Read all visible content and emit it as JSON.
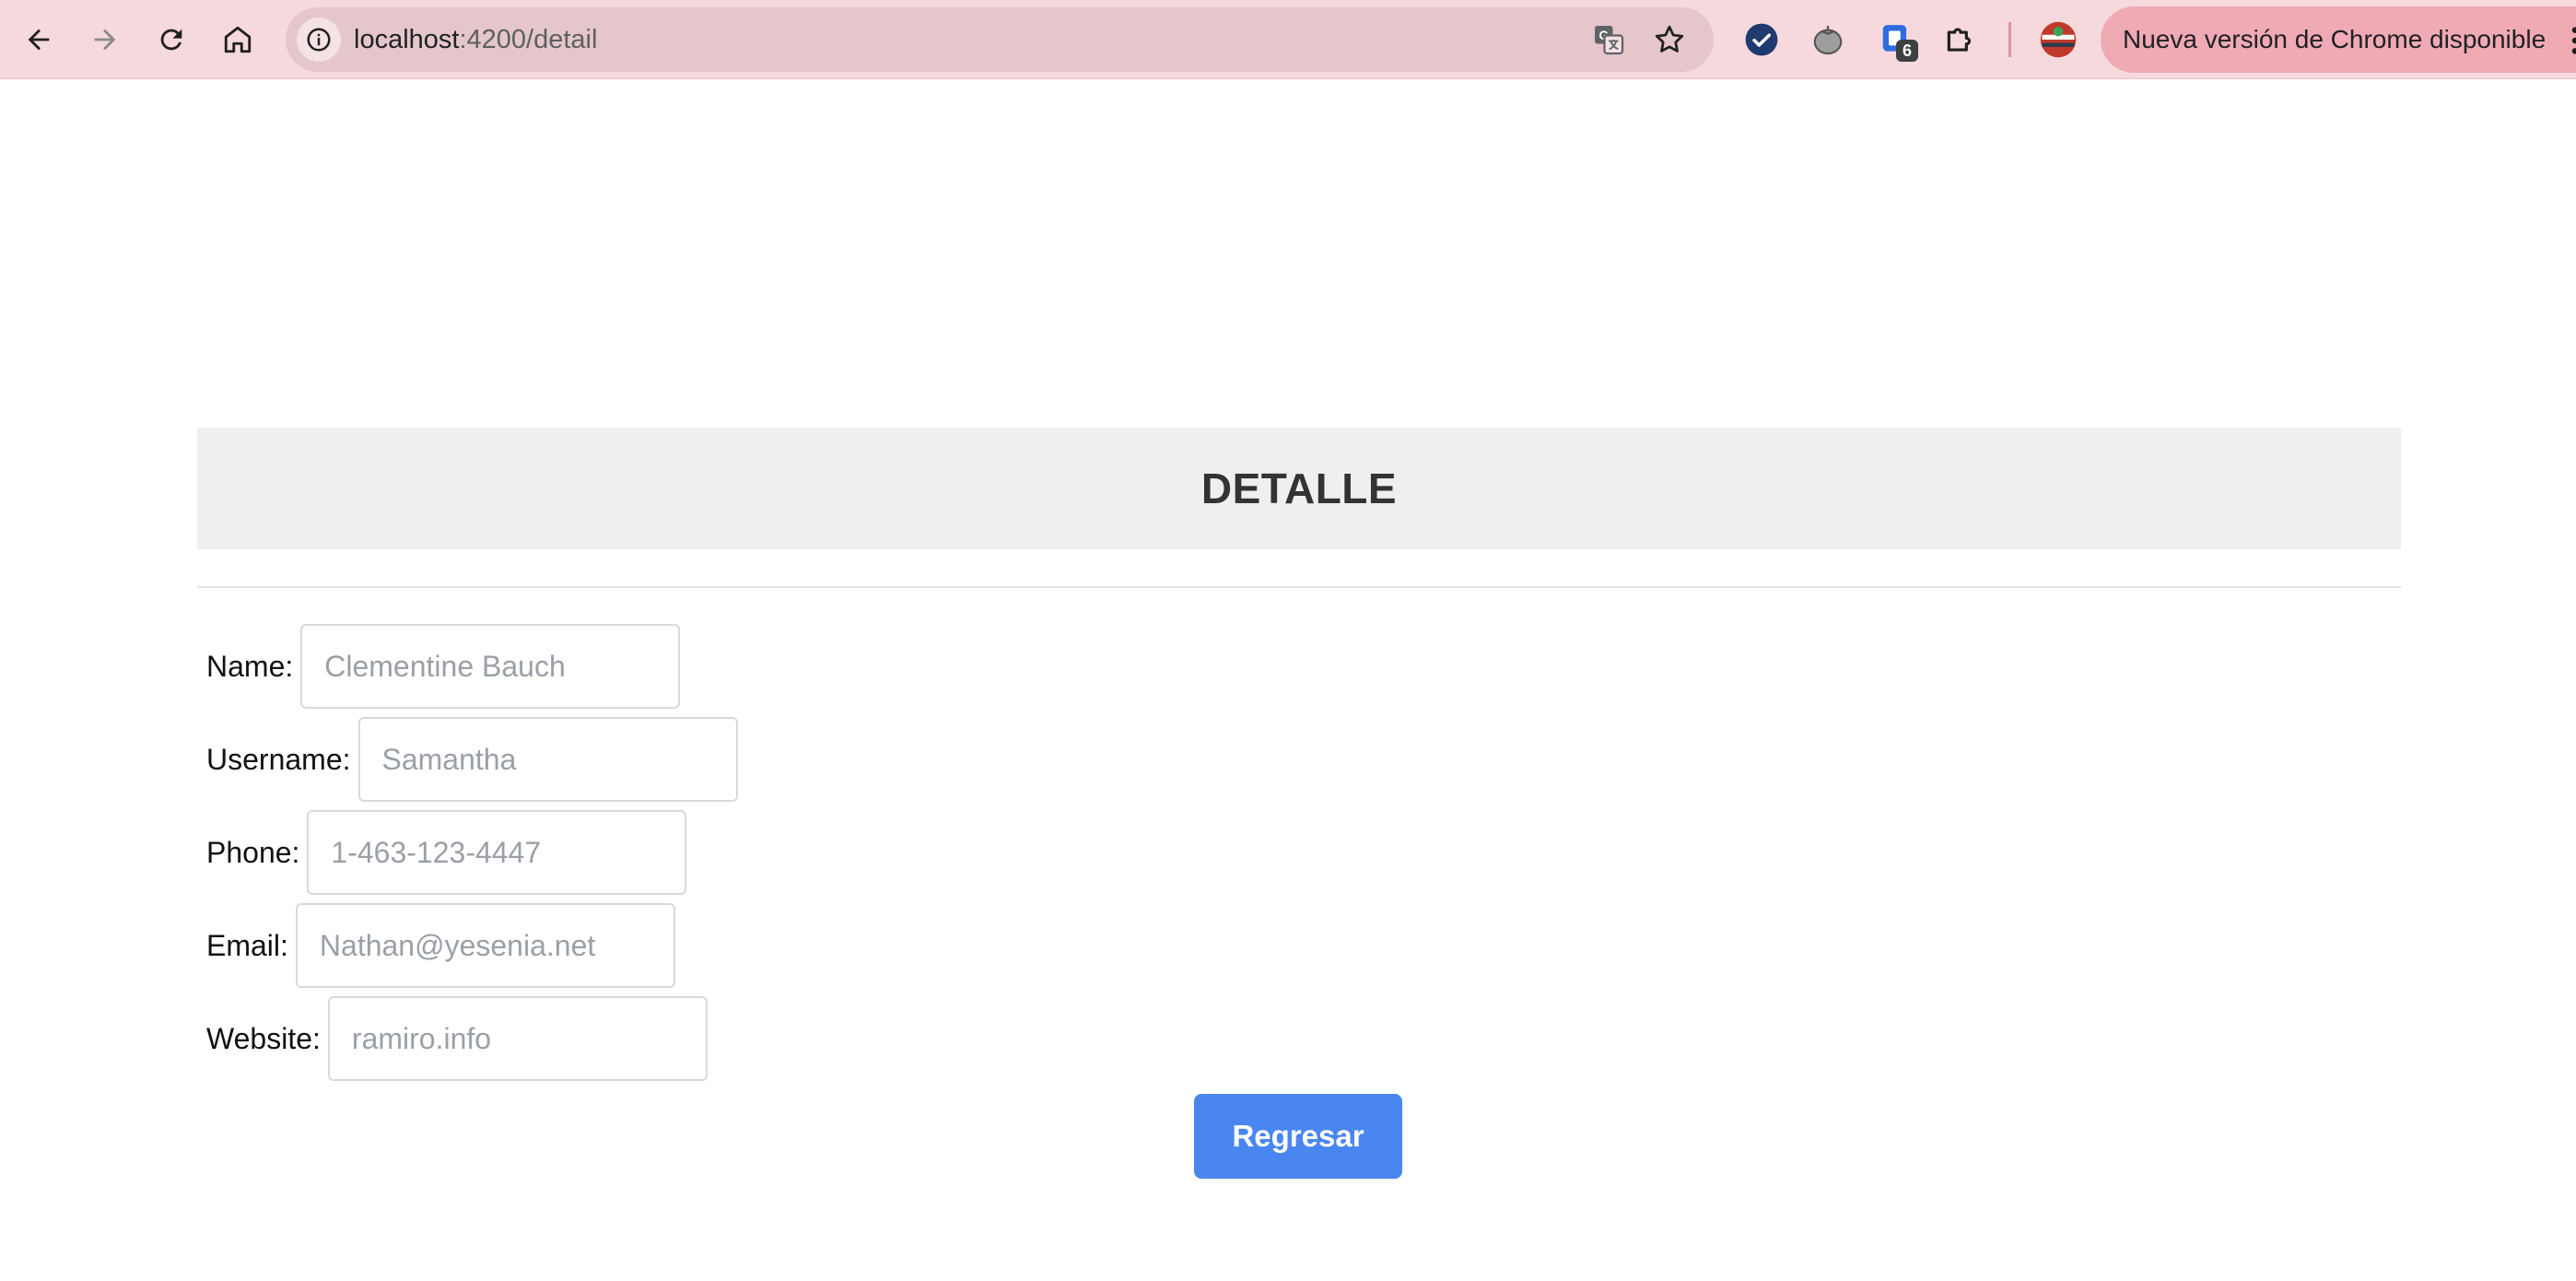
{
  "browser": {
    "url_host": "localhost",
    "url_path": ":4200/detail",
    "extension_badge": "6",
    "update_label": "Nueva versión de Chrome disponible",
    "icons": [
      "back-arrow-icon",
      "forward-arrow-icon",
      "reload-icon",
      "home-icon",
      "site-info-icon",
      "translate-icon",
      "bookmark-star-icon",
      "checkmark-extension-icon",
      "tomato-extension-icon",
      "badge-extension-icon",
      "puzzle-extensions-icon",
      "profile-avatar-icon",
      "more-vert-icon"
    ]
  },
  "page": {
    "title": "DETALLE",
    "fields": [
      {
        "label": "Name:",
        "placeholder": "Clementine Bauch"
      },
      {
        "label": "Username:",
        "placeholder": "Samantha"
      },
      {
        "label": "Phone:",
        "placeholder": "1-463-123-4447"
      },
      {
        "label": "Email:",
        "placeholder": "Nathan@yesenia.net"
      },
      {
        "label": "Website:",
        "placeholder": "ramiro.info"
      }
    ],
    "back_button": "Regresar"
  },
  "colors": {
    "toolbar": "#f6d9dd",
    "omnibox": "#e4c6cb",
    "update_pill": "#f0aab4",
    "header_band": "#efefef",
    "button": "#4a86f0"
  }
}
